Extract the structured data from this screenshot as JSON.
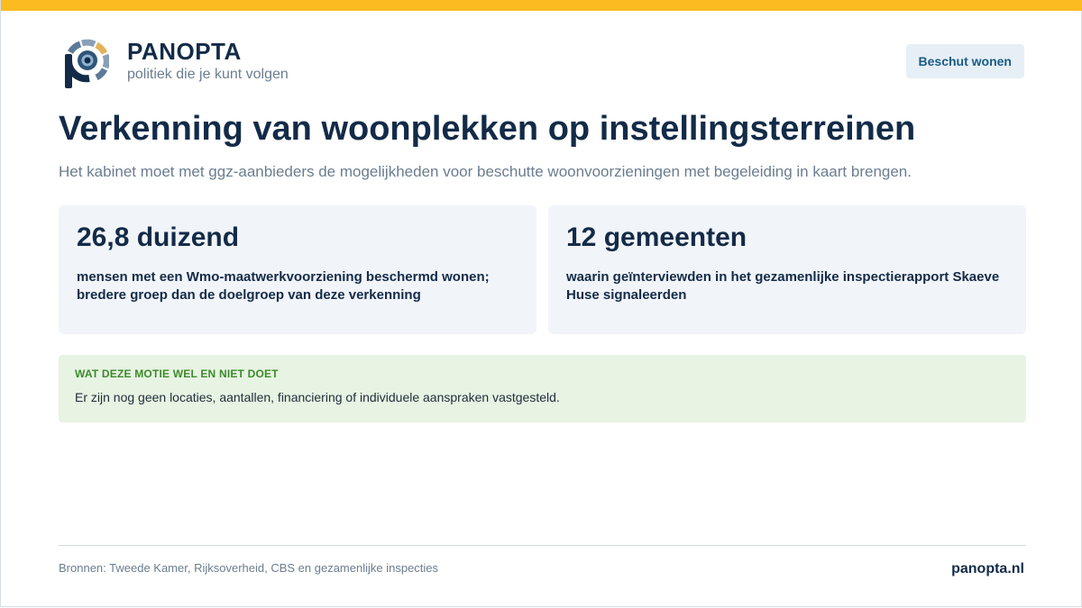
{
  "header": {
    "brand_name": "PANOPTA",
    "tagline": "politiek die je kunt volgen",
    "topic_button": "Beschut wonen"
  },
  "main": {
    "title": "Verkenning van woonplekken op instellingsterreinen",
    "subtitle": "Het kabinet moet met ggz-aanbieders de mogelijkheden voor beschutte woonvoorzieningen met begeleiding in kaart brengen.",
    "stats": [
      {
        "value": "26,8 duizend",
        "label": "mensen met een Wmo-maatwerkvoorziening beschermd wonen; bredere groep dan de doelgroep van deze verkenning"
      },
      {
        "value": "12 gemeenten",
        "label": "waarin geïnterviewden in het gezamenlijke inspectierapport Skaeve Huse signaleerden"
      }
    ],
    "note": {
      "heading": "WAT DEZE MOTIE WEL EN NIET DOET",
      "text": "Er zijn nog geen locaties, aantallen, financiering of individuele aanspraken vastgesteld."
    }
  },
  "footer": {
    "sources": "Bronnen: Tweede Kamer, Rijksoverheid, CBS en gezamenlijke inspecties",
    "site": "panopta.nl"
  },
  "colors": {
    "accent_bar": "#fbbb21",
    "brand_navy": "#132b48",
    "card_bg": "#f1f4f8",
    "note_bg": "#e7f3e3",
    "note_heading": "#3c8a2a"
  }
}
